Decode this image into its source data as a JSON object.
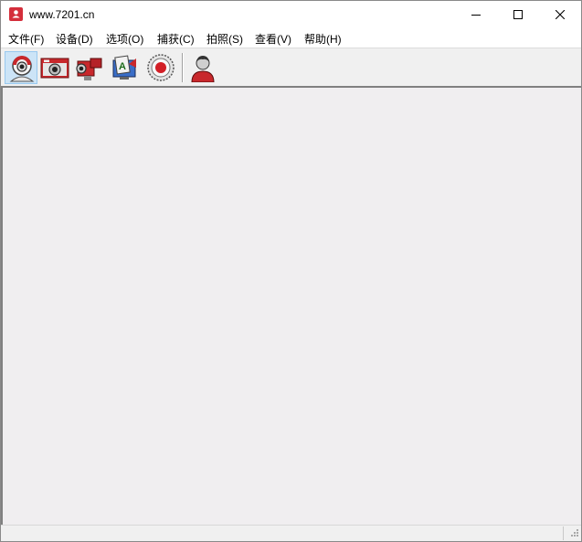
{
  "window": {
    "title": "www.7201.cn",
    "app_icon": "user-photo-icon",
    "accent_color": "#d42e3b",
    "controls": {
      "minimize": "minimize-icon",
      "maximize": "maximize-icon",
      "close": "close-icon"
    }
  },
  "menubar": {
    "items": [
      {
        "label": "文件(F)"
      },
      {
        "label": "设备(D)"
      },
      {
        "label": "选项(O)"
      },
      {
        "label": "捕获(C)"
      },
      {
        "label": "拍照(S)"
      },
      {
        "label": "查看(V)"
      },
      {
        "label": "帮助(H)"
      }
    ]
  },
  "toolbar": {
    "buttons": [
      {
        "icon": "webcam-icon",
        "active": true
      },
      {
        "icon": "camera-icon",
        "active": false
      },
      {
        "icon": "video-camera-icon",
        "active": false
      },
      {
        "icon": "monitor-app-icon",
        "active": false
      },
      {
        "icon": "record-icon",
        "active": false
      },
      {
        "icon": "user-avatar-icon",
        "active": false
      }
    ]
  },
  "client": {
    "background_color": "#f0eef0"
  },
  "statusbar": {
    "text": ""
  }
}
